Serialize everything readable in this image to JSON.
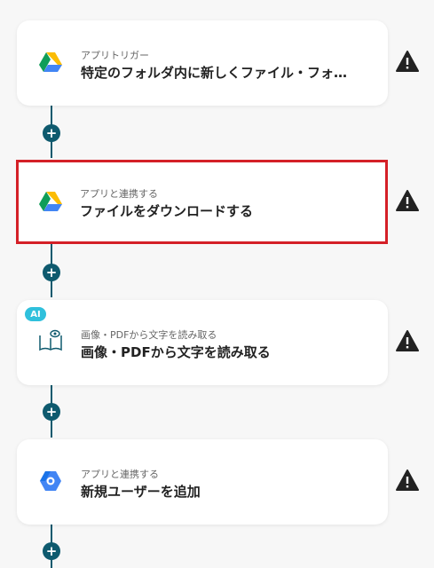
{
  "flow": {
    "steps": [
      {
        "subtitle": "アプリトリガー",
        "title": "特定のフォルダ内に新しくファイル・フォ…",
        "icon": "google-drive-icon",
        "warning_icon": "warning-icon"
      },
      {
        "subtitle": "アプリと連携する",
        "title": "ファイルをダウンロードする",
        "icon": "google-drive-icon",
        "warning_icon": "warning-icon",
        "selected": true
      },
      {
        "subtitle": "画像・PDFから文字を読み取る",
        "title": "画像・PDFから文字を読み取る",
        "icon": "ocr-book-eye-icon",
        "badge": "AI",
        "warning_icon": "warning-icon"
      },
      {
        "subtitle": "アプリと連携する",
        "title": "新規ユーザーを追加",
        "icon": "google-workspace-icon",
        "warning_icon": "warning-icon"
      }
    ],
    "add_button_label": "+"
  },
  "colors": {
    "connector": "#0e5a6e",
    "selected_border": "#d42027",
    "ai_badge": "#2fc0dc",
    "background": "#f7f7f7"
  }
}
